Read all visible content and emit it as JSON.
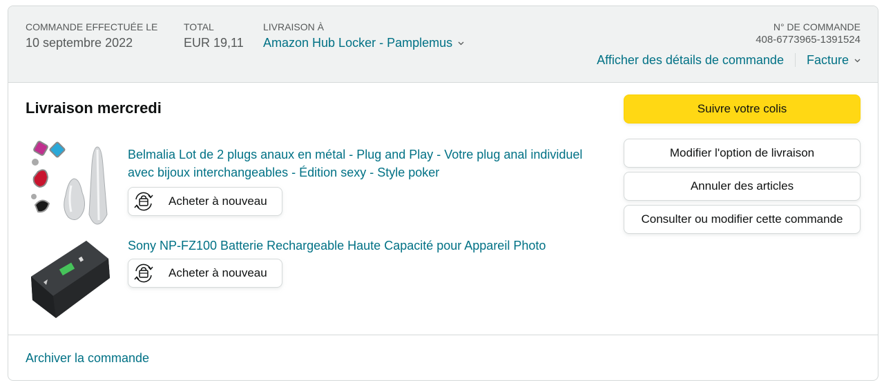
{
  "header": {
    "order_placed_label": "COMMANDE EFFECTUÉE LE",
    "order_placed_value": "10 septembre 2022",
    "total_label": "TOTAL",
    "total_value": "EUR 19,11",
    "ship_to_label": "LIVRAISON À",
    "ship_to_value": "Amazon Hub Locker - Pamplemus",
    "order_number_label": "N° DE COMMANDE",
    "order_number_value": "408-6773965-1391524",
    "details_link": "Afficher des détails de commande",
    "invoice_link": "Facture"
  },
  "delivery": {
    "title": "Livraison mercredi"
  },
  "items": [
    {
      "title": "Belmalia Lot de 2 plugs anaux en métal - Plug and Play - Votre plug anal individuel avec bijoux interchangeables - Édition sexy - Style poker",
      "buy_again_label": "Acheter à nouveau"
    },
    {
      "title": "Sony NP-FZ100 Batterie Rechargeable Haute Capacité pour Appareil Photo",
      "buy_again_label": "Acheter à nouveau"
    }
  ],
  "actions": {
    "track": "Suivre votre colis",
    "change_delivery": "Modifier l'option de livraison",
    "cancel_items": "Annuler des articles",
    "view_edit_order": "Consulter ou modifier cette commande"
  },
  "footer": {
    "archive": "Archiver la commande"
  },
  "colors": {
    "link": "#007185",
    "primary_button": "#ffd814",
    "header_bg": "#f0f2f2",
    "border": "#d5d9d9"
  },
  "icons": [
    "chevron-down-icon",
    "buy-again-icon"
  ]
}
